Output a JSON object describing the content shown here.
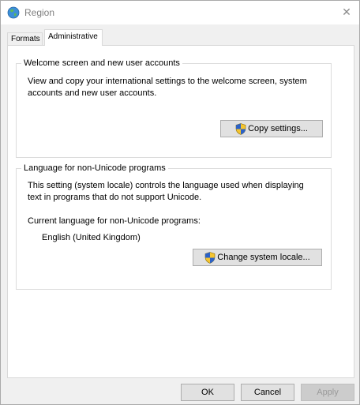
{
  "window": {
    "title": "Region",
    "title_icon": "globe-icon",
    "close_icon": "close-icon",
    "close_glyph": "✕"
  },
  "tabs": [
    {
      "label": "Formats",
      "active": false
    },
    {
      "label": "Administrative",
      "active": true
    }
  ],
  "welcome_group": {
    "legend": "Welcome screen and new user accounts",
    "line1": "View and copy your international settings to the welcome screen, system",
    "line2": "accounts and new user accounts.",
    "button_label": "Copy settings...",
    "button_icon": "uac-shield-icon"
  },
  "unicode_group": {
    "legend": "Language for non-Unicode programs",
    "line1": "This setting (system locale) controls the language used when displaying",
    "line2": "text in programs that do not support Unicode.",
    "current_label": "Current language for non-Unicode programs:",
    "current_value": "English (United Kingdom)",
    "button_label": "Change system locale...",
    "button_icon": "uac-shield-icon"
  },
  "footer": {
    "ok_label": "OK",
    "cancel_label": "Cancel",
    "apply_label": "Apply",
    "apply_disabled": true
  },
  "colors": {
    "window_bg": "#f0f0f0",
    "panel_bg": "#ffffff",
    "border": "#dcdcdc",
    "button_bg": "#e1e1e1",
    "disabled_text": "#9a9a9a"
  }
}
